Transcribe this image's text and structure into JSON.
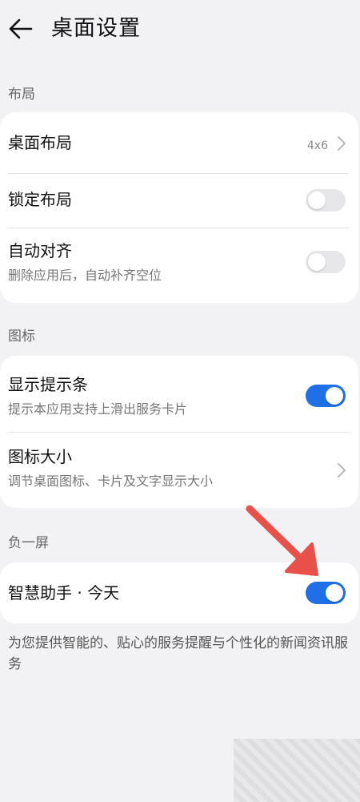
{
  "header": {
    "title": "桌面设置",
    "back_icon": "arrow-left-icon"
  },
  "sections": [
    {
      "label": "布局",
      "rows": [
        {
          "title": "桌面布局",
          "value": "4x6",
          "control": "chevron"
        },
        {
          "title": "锁定布局",
          "control": "toggle",
          "on": false
        },
        {
          "title": "自动对齐",
          "subtitle": "删除应用后，自动补齐空位",
          "control": "toggle",
          "on": false
        }
      ]
    },
    {
      "label": "图标",
      "rows": [
        {
          "title": "显示提示条",
          "subtitle": "提示本应用支持上滑出服务卡片",
          "control": "toggle",
          "on": true
        },
        {
          "title": "图标大小",
          "subtitle": "调节桌面图标、卡片及文字显示大小",
          "control": "chevron"
        }
      ]
    },
    {
      "label": "负一屏",
      "rows": [
        {
          "title": "智慧助手 · 今天",
          "control": "toggle",
          "on": true
        }
      ]
    }
  ],
  "footnote": "为您提供智能的、贴心的服务提醒与个性化的新闻资讯服务",
  "colors": {
    "accent": "#1f6fe6",
    "annotation_arrow": "#e8504a",
    "background": "#f2f2f4"
  }
}
